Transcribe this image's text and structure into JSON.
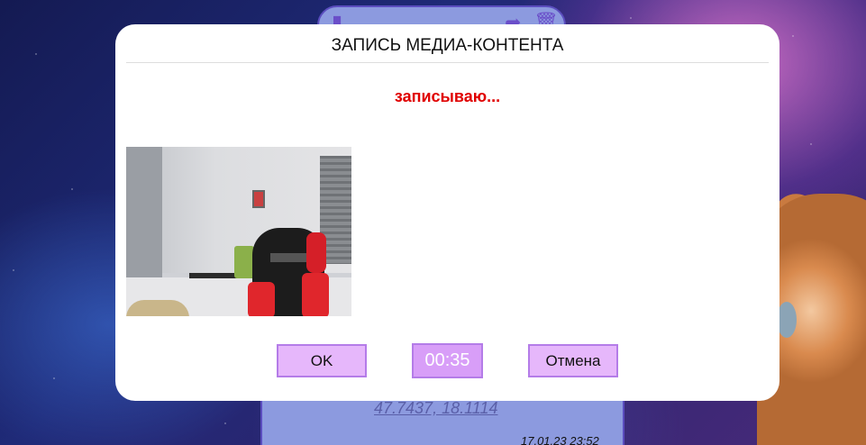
{
  "background": {
    "chat": {
      "header_icons": [
        "pin-icon",
        "share-icon",
        "trash-icon"
      ],
      "coordinates_link": "47.7437, 18.1114",
      "timestamp": "17.01.23 23:52"
    }
  },
  "modal": {
    "title": "ЗАПИСЬ МЕДИА-КОНТЕНТА",
    "status": "записываю...",
    "status_color": "#e00000",
    "buttons": {
      "ok_label": "OK",
      "timer": "00:35",
      "cancel_label": "Отмена"
    },
    "button_color": "#e6b7fb",
    "button_border": "#b47ce8"
  }
}
